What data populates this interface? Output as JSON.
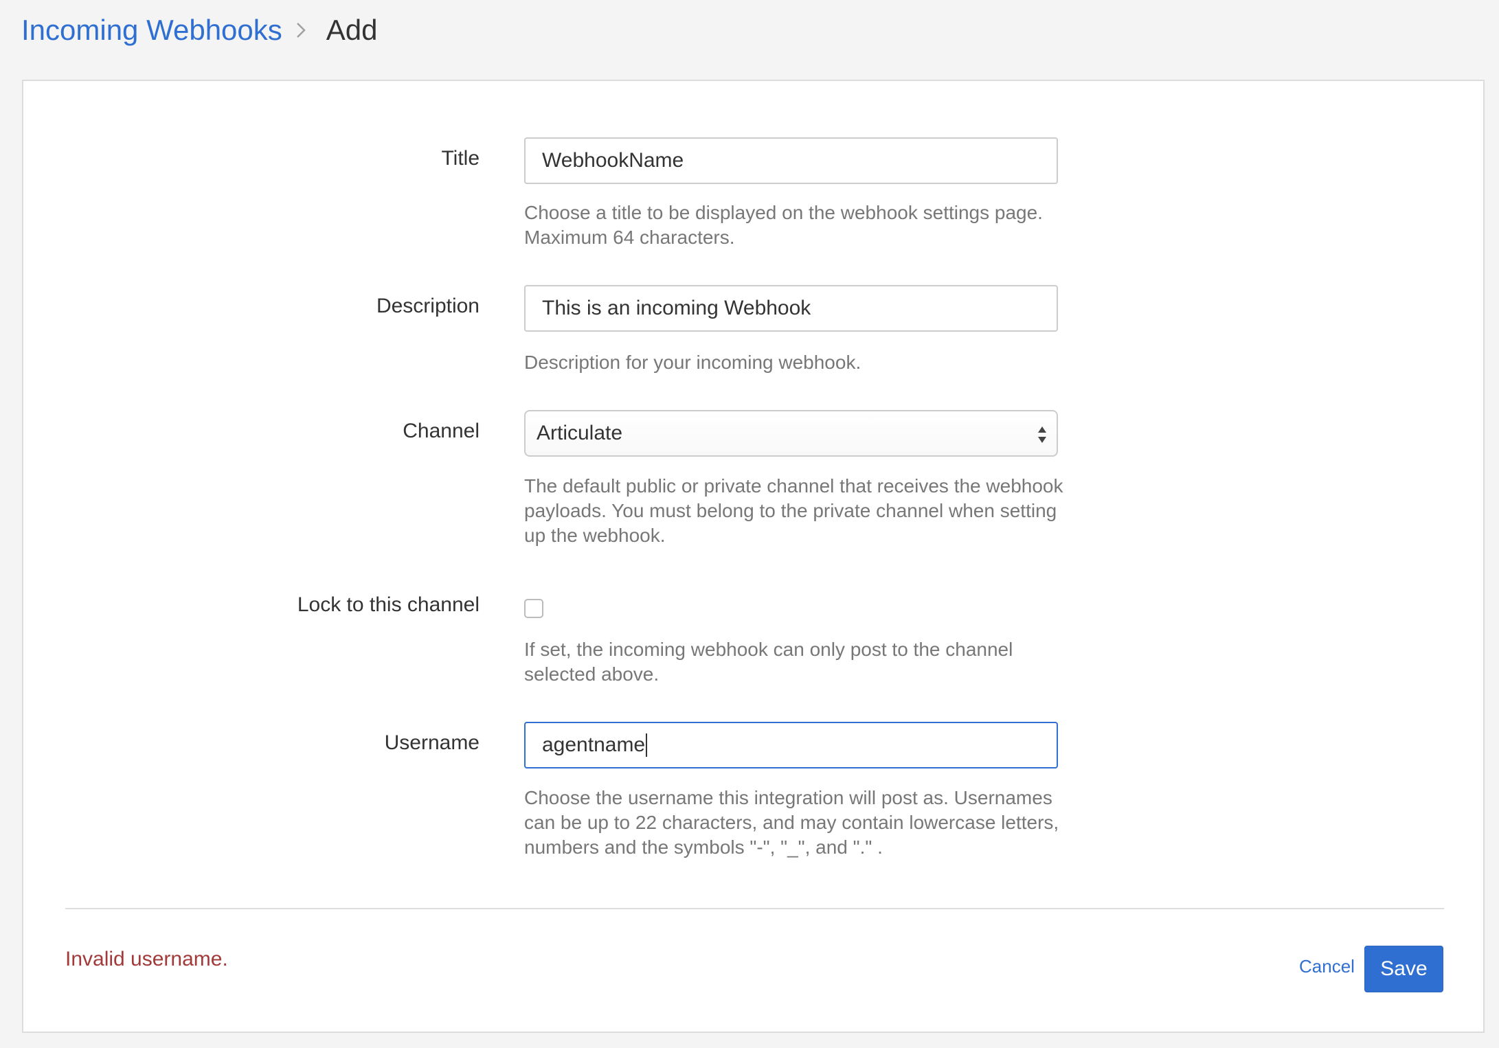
{
  "breadcrumb": {
    "parent": "Incoming Webhooks",
    "current": "Add"
  },
  "form": {
    "title": {
      "label": "Title",
      "value": "WebhookName",
      "help": "Choose a title to be displayed on the webhook settings page. Maximum 64 characters."
    },
    "description": {
      "label": "Description",
      "value": "This is an incoming Webhook",
      "help": "Description for your incoming webhook."
    },
    "channel": {
      "label": "Channel",
      "selected": "Articulate",
      "help": "The default public or private channel that receives the webhook payloads. You must belong to the private channel when setting up the webhook."
    },
    "lock_channel": {
      "label": "Lock to this channel",
      "checked": false,
      "help": "If set, the incoming webhook can only post to the channel selected above."
    },
    "username": {
      "label": "Username",
      "value": "agentname",
      "help": "Choose the username this integration will post as. Usernames can be up to 22 characters, and may contain lowercase letters, numbers and the symbols \"-\", \"_\", and \".\" ."
    }
  },
  "footer": {
    "error": "Invalid username.",
    "cancel_label": "Cancel",
    "save_label": "Save"
  },
  "colors": {
    "accent": "#2f6fd1",
    "error": "#a33a3a",
    "background": "#f4f4f4"
  }
}
